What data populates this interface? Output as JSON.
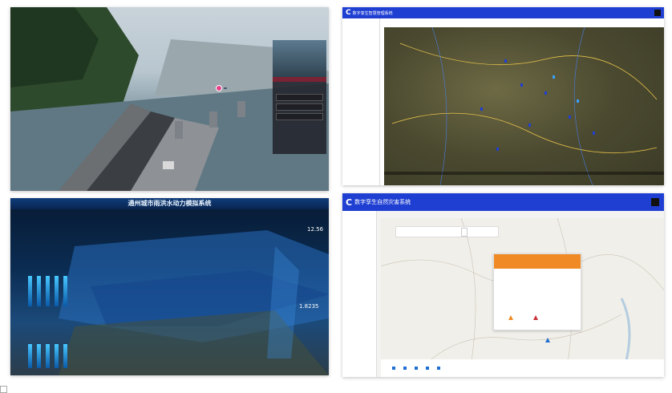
{
  "panel1": {
    "logo": "",
    "marker_label": "",
    "card_header": "",
    "card_text": "",
    "card_buttons": [
      "",
      ""
    ],
    "card_footer": ""
  },
  "panel2": {
    "app_title": "数字孪生智慧管理系统",
    "nav": [
      "",
      "",
      "",
      "",
      "",
      ""
    ],
    "sidebar": [
      "",
      "",
      "",
      "",
      "",
      ""
    ],
    "breadcrumb": "",
    "accent": "#1f3fd3"
  },
  "panel3": {
    "title": "通州城市雨洪水动力模拟系统",
    "value_a": "12.56",
    "value_b": "1.8235",
    "bar_levels": [
      0.85,
      0.85,
      0.85,
      0.85,
      0.85
    ],
    "bar_levels_b": [
      0.72,
      0.72,
      0.72,
      0.72,
      0.72
    ]
  },
  "panel4": {
    "app_title": "数字孪生自然灾害系统",
    "nav": [
      "",
      "",
      "",
      "",
      ""
    ],
    "sidebar": [
      "",
      "",
      ""
    ],
    "breadcrumb": "",
    "search_text": "",
    "select_text": "",
    "alert_title": "",
    "alert_body": "",
    "legend": [
      "",
      "",
      "",
      "",
      ""
    ],
    "accent": "#1f3fd3",
    "warning_color": "#f08a24"
  }
}
